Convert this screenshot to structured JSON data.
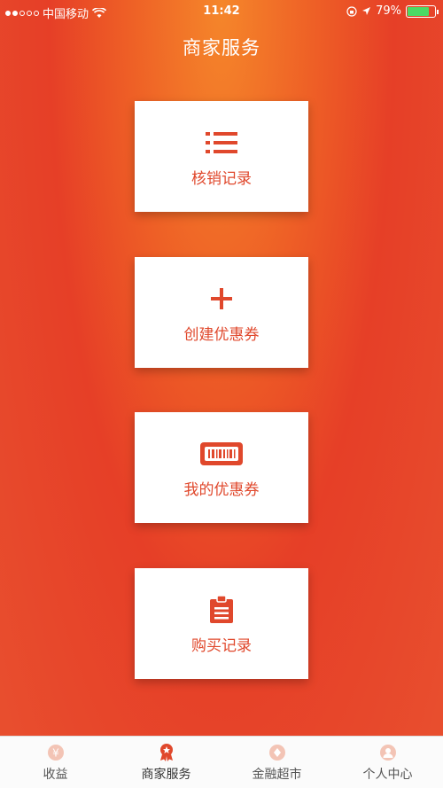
{
  "status_bar": {
    "carrier": "中国移动",
    "time": "11:42",
    "battery": "79%",
    "battery_level": 0.79
  },
  "header": {
    "title": "商家服务"
  },
  "cards": [
    {
      "label": "核销记录",
      "icon": "list-icon"
    },
    {
      "label": "创建优惠券",
      "icon": "plus-icon"
    },
    {
      "label": "我的优惠券",
      "icon": "ticket-icon"
    },
    {
      "label": "购买记录",
      "icon": "clipboard-icon"
    }
  ],
  "tabbar": {
    "items": [
      {
        "label": "收益",
        "icon": "yen-icon"
      },
      {
        "label": "商家服务",
        "icon": "badge-icon",
        "active": true
      },
      {
        "label": "金融超市",
        "icon": "diamond-icon"
      },
      {
        "label": "个人中心",
        "icon": "person-icon"
      }
    ]
  },
  "colors": {
    "accent": "#e0482c",
    "background_top": "#f5862a",
    "background_mid": "#e63f27"
  }
}
